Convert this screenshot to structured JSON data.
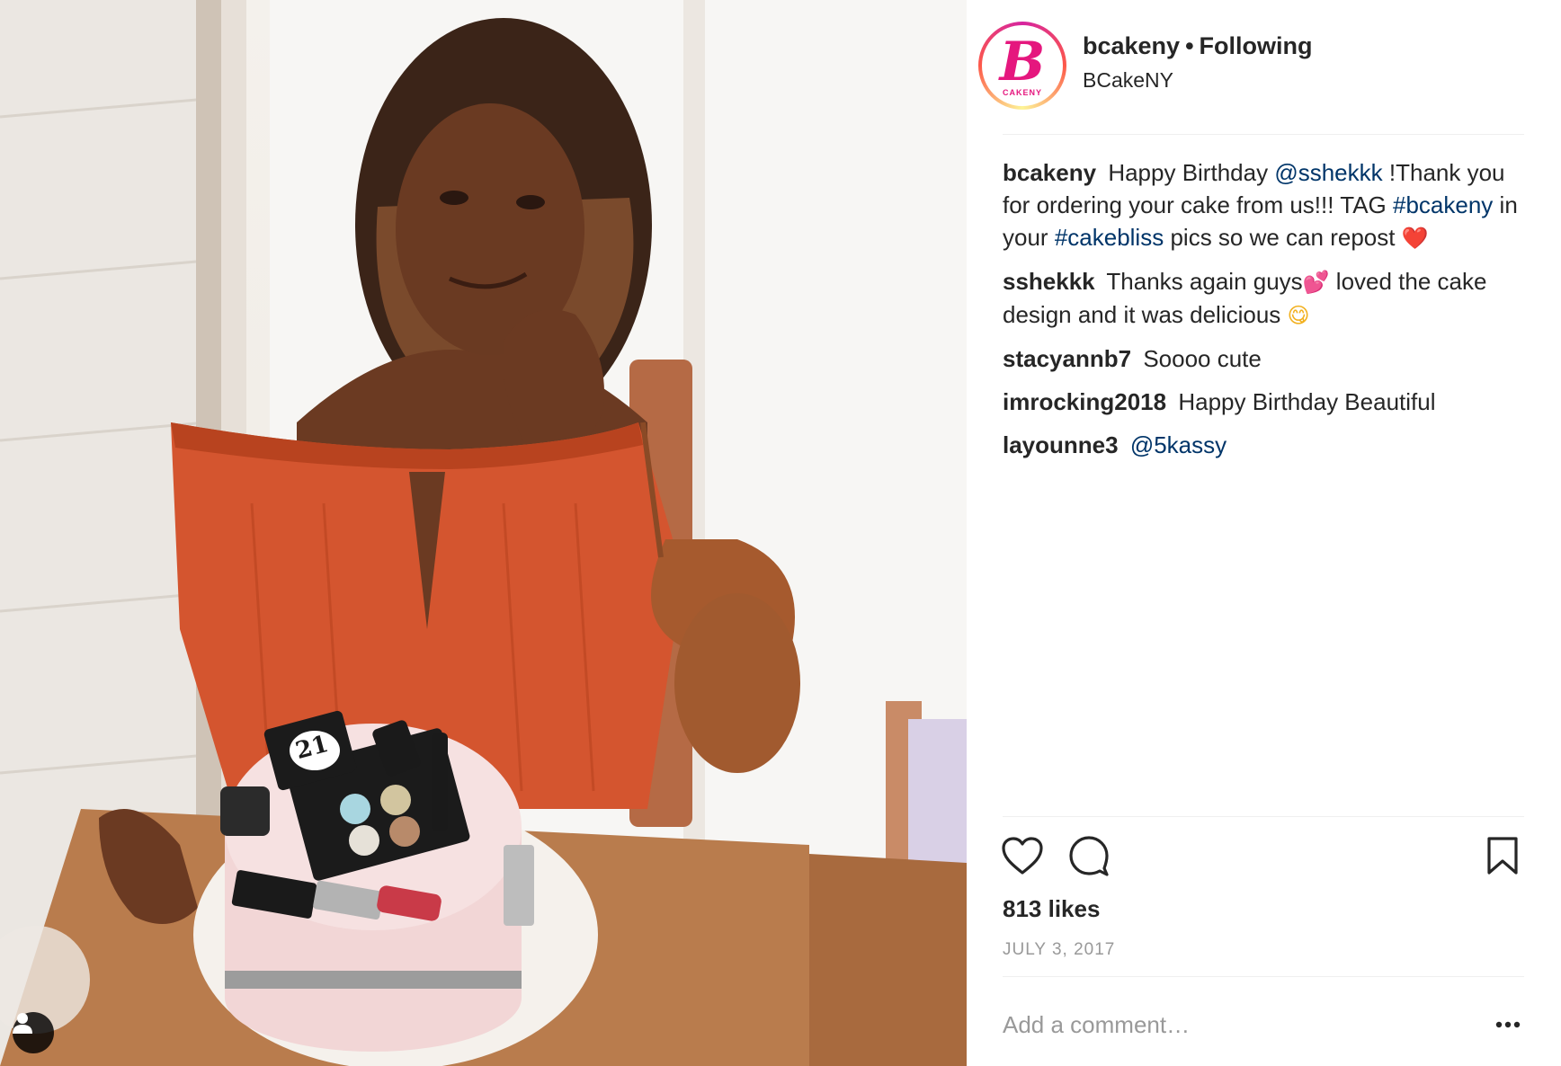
{
  "post": {
    "account": {
      "username": "bcakeny",
      "separator": "•",
      "follow_state": "Following",
      "display_name": "BCakeNY",
      "avatar_icon": "bcakeny-logo-icon",
      "avatar_logo_letter": "B",
      "avatar_logo_text": "CAKENY"
    },
    "photo": {
      "description_icon": "post-photo",
      "cake_topper_number": "21",
      "tag_icon": "user-tag-icon"
    },
    "caption": {
      "author": "bcakeny",
      "text_1": "Happy Birthday",
      "mention": "@sshekkk",
      "text_2": "!Thank you for ordering your cake from us!!! TAG",
      "hashtag_1": "#bcakeny",
      "text_3": "in your",
      "hashtag_2": "#cakebliss",
      "text_4": "pics so we can repost",
      "emoji": "❤️"
    },
    "comments": [
      {
        "author": "sshekkk",
        "text_1": "Thanks again guys",
        "emoji_1": "💕",
        "text_2": "loved the cake design and it was delicious",
        "emoji_2": "😋"
      },
      {
        "author": "stacyannb7",
        "text": "Soooo cute"
      },
      {
        "author": "imrocking2018",
        "text": "Happy Birthday Beautiful"
      },
      {
        "author": "layounne3",
        "mention": "@5kassy"
      }
    ],
    "actions": {
      "like_icon": "heart-icon",
      "comment_icon": "comment-bubble-icon",
      "save_icon": "bookmark-icon"
    },
    "likes": "813 likes",
    "date": "JULY 3, 2017",
    "add_comment_placeholder": "Add a comment…",
    "more_icon": "more-options-icon",
    "colors": {
      "link": "#003569",
      "muted": "#999999",
      "text": "#262626",
      "brand_pink": "#e5177e"
    }
  }
}
